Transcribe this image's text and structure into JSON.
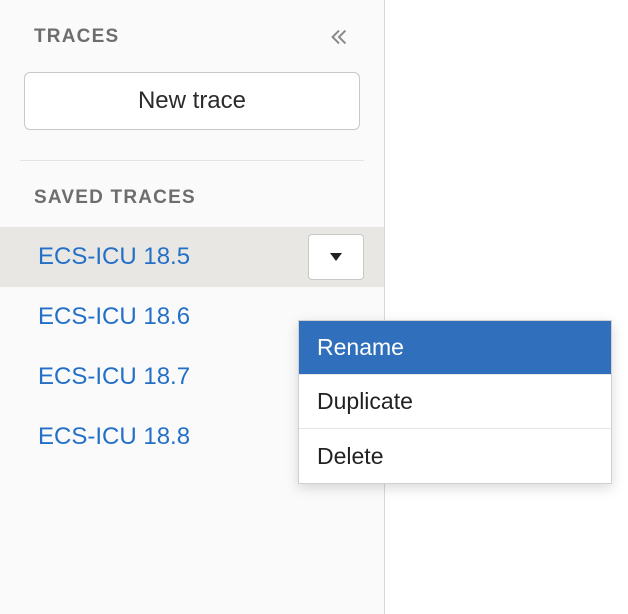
{
  "sidebar": {
    "traces_section_title": "TRACES",
    "new_trace_label": "New trace",
    "saved_section_title": "SAVED TRACES",
    "saved_traces": [
      {
        "label": "ECS-ICU 18.5",
        "selected": true
      },
      {
        "label": "ECS-ICU 18.6",
        "selected": false
      },
      {
        "label": "ECS-ICU 18.7",
        "selected": false
      },
      {
        "label": "ECS-ICU 18.8",
        "selected": false
      }
    ]
  },
  "context_menu": {
    "items": [
      {
        "label": "Rename",
        "highlighted": true
      },
      {
        "label": "Duplicate",
        "highlighted": false
      },
      {
        "label": "Delete",
        "highlighted": false
      }
    ]
  }
}
